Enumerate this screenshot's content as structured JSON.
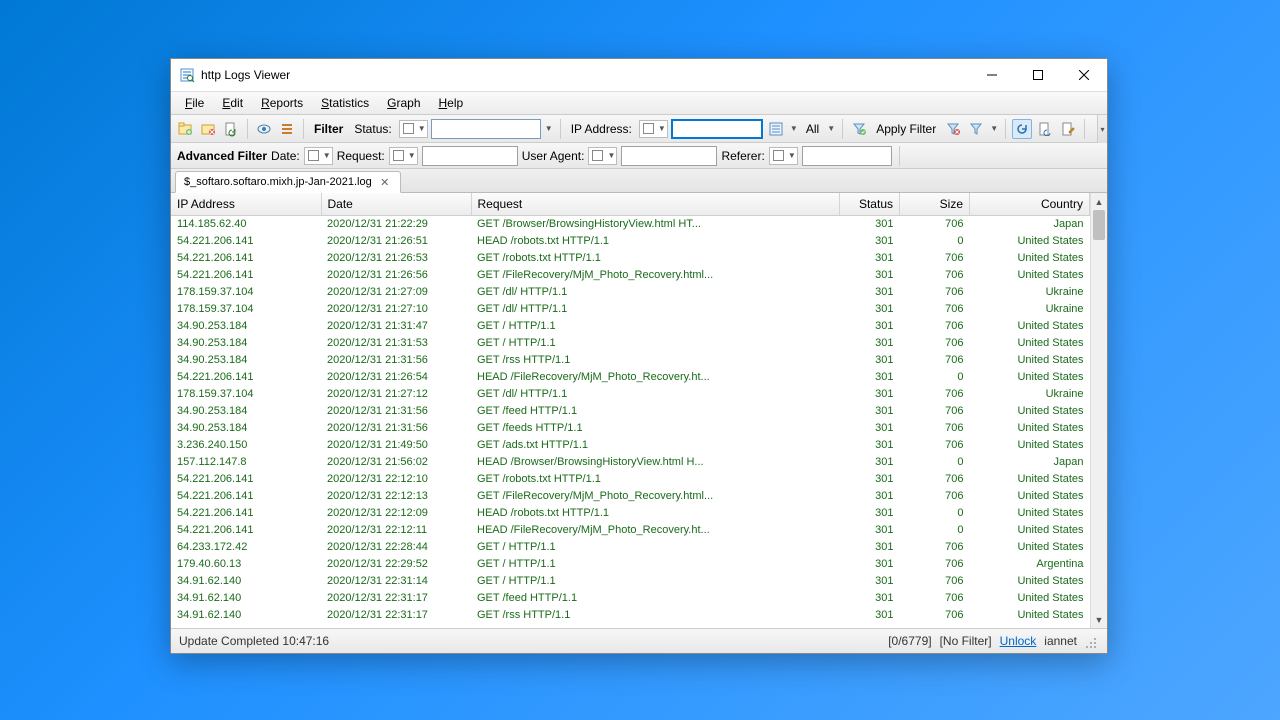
{
  "title": "http Logs Viewer",
  "menu": {
    "file": "File",
    "edit": "Edit",
    "reports": "Reports",
    "statistics": "Statistics",
    "graph": "Graph",
    "help": "Help"
  },
  "toolbar": {
    "filter": "Filter",
    "status": "Status:",
    "ipaddress": "IP Address:",
    "all": "All",
    "apply": "Apply Filter"
  },
  "advfilter": {
    "label": "Advanced Filter",
    "date": "Date:",
    "request": "Request:",
    "useragent": "User Agent:",
    "referer": "Referer:"
  },
  "tab": {
    "name": "$_softaro.softaro.mixh.jp-Jan-2021.log"
  },
  "columns": {
    "ip": "IP Address",
    "date": "Date",
    "request": "Request",
    "status": "Status",
    "size": "Size",
    "country": "Country"
  },
  "rows": [
    {
      "ip": "114.185.62.40",
      "date": "2020/12/31 21:22:29",
      "request": "GET /Browser/BrowsingHistoryView.html HT...",
      "status": "301",
      "size": "706",
      "country": "Japan"
    },
    {
      "ip": "54.221.206.141",
      "date": "2020/12/31 21:26:51",
      "request": "HEAD /robots.txt HTTP/1.1",
      "status": "301",
      "size": "0",
      "country": "United States"
    },
    {
      "ip": "54.221.206.141",
      "date": "2020/12/31 21:26:53",
      "request": "GET /robots.txt HTTP/1.1",
      "status": "301",
      "size": "706",
      "country": "United States"
    },
    {
      "ip": "54.221.206.141",
      "date": "2020/12/31 21:26:56",
      "request": "GET /FileRecovery/MjM_Photo_Recovery.html...",
      "status": "301",
      "size": "706",
      "country": "United States"
    },
    {
      "ip": "178.159.37.104",
      "date": "2020/12/31 21:27:09",
      "request": "GET /dl/ HTTP/1.1",
      "status": "301",
      "size": "706",
      "country": "Ukraine"
    },
    {
      "ip": "178.159.37.104",
      "date": "2020/12/31 21:27:10",
      "request": "GET /dl/ HTTP/1.1",
      "status": "301",
      "size": "706",
      "country": "Ukraine"
    },
    {
      "ip": "34.90.253.184",
      "date": "2020/12/31 21:31:47",
      "request": "GET / HTTP/1.1",
      "status": "301",
      "size": "706",
      "country": "United States"
    },
    {
      "ip": "34.90.253.184",
      "date": "2020/12/31 21:31:53",
      "request": "GET / HTTP/1.1",
      "status": "301",
      "size": "706",
      "country": "United States"
    },
    {
      "ip": "34.90.253.184",
      "date": "2020/12/31 21:31:56",
      "request": "GET /rss HTTP/1.1",
      "status": "301",
      "size": "706",
      "country": "United States"
    },
    {
      "ip": "54.221.206.141",
      "date": "2020/12/31 21:26:54",
      "request": "HEAD /FileRecovery/MjM_Photo_Recovery.ht...",
      "status": "301",
      "size": "0",
      "country": "United States"
    },
    {
      "ip": "178.159.37.104",
      "date": "2020/12/31 21:27:12",
      "request": "GET /dl/ HTTP/1.1",
      "status": "301",
      "size": "706",
      "country": "Ukraine"
    },
    {
      "ip": "34.90.253.184",
      "date": "2020/12/31 21:31:56",
      "request": "GET /feed HTTP/1.1",
      "status": "301",
      "size": "706",
      "country": "United States"
    },
    {
      "ip": "34.90.253.184",
      "date": "2020/12/31 21:31:56",
      "request": "GET /feeds HTTP/1.1",
      "status": "301",
      "size": "706",
      "country": "United States"
    },
    {
      "ip": "3.236.240.150",
      "date": "2020/12/31 21:49:50",
      "request": "GET /ads.txt HTTP/1.1",
      "status": "301",
      "size": "706",
      "country": "United States"
    },
    {
      "ip": "157.112.147.8",
      "date": "2020/12/31 21:56:02",
      "request": "HEAD /Browser/BrowsingHistoryView.html H...",
      "status": "301",
      "size": "0",
      "country": "Japan"
    },
    {
      "ip": "54.221.206.141",
      "date": "2020/12/31 22:12:10",
      "request": "GET /robots.txt HTTP/1.1",
      "status": "301",
      "size": "706",
      "country": "United States"
    },
    {
      "ip": "54.221.206.141",
      "date": "2020/12/31 22:12:13",
      "request": "GET /FileRecovery/MjM_Photo_Recovery.html...",
      "status": "301",
      "size": "706",
      "country": "United States"
    },
    {
      "ip": "54.221.206.141",
      "date": "2020/12/31 22:12:09",
      "request": "HEAD /robots.txt HTTP/1.1",
      "status": "301",
      "size": "0",
      "country": "United States"
    },
    {
      "ip": "54.221.206.141",
      "date": "2020/12/31 22:12:11",
      "request": "HEAD /FileRecovery/MjM_Photo_Recovery.ht...",
      "status": "301",
      "size": "0",
      "country": "United States"
    },
    {
      "ip": "64.233.172.42",
      "date": "2020/12/31 22:28:44",
      "request": "GET / HTTP/1.1",
      "status": "301",
      "size": "706",
      "country": "United States"
    },
    {
      "ip": "179.40.60.13",
      "date": "2020/12/31 22:29:52",
      "request": "GET / HTTP/1.1",
      "status": "301",
      "size": "706",
      "country": "Argentina"
    },
    {
      "ip": "34.91.62.140",
      "date": "2020/12/31 22:31:14",
      "request": "GET / HTTP/1.1",
      "status": "301",
      "size": "706",
      "country": "United States"
    },
    {
      "ip": "34.91.62.140",
      "date": "2020/12/31 22:31:17",
      "request": "GET /feed HTTP/1.1",
      "status": "301",
      "size": "706",
      "country": "United States"
    },
    {
      "ip": "34.91.62.140",
      "date": "2020/12/31 22:31:17",
      "request": "GET /rss HTTP/1.1",
      "status": "301",
      "size": "706",
      "country": "United States"
    }
  ],
  "status": {
    "msg": "Update Completed 10:47:16",
    "counter": "[0/6779]",
    "filter": "[No Filter]",
    "unlock": "Unlock",
    "user": "iannet"
  }
}
